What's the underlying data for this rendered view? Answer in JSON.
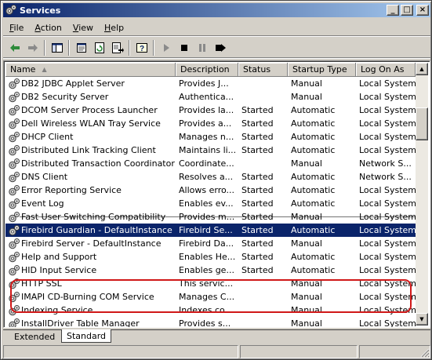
{
  "window": {
    "title": "Services",
    "minimize": "_",
    "maximize": "□",
    "close": "×"
  },
  "menu": [
    "File",
    "Action",
    "View",
    "Help"
  ],
  "toolbar": {
    "buttons": [
      "back-icon",
      "forward-icon",
      "show-hide-tree-icon",
      "properties-icon",
      "refresh-icon",
      "export-list-icon",
      "help-icon",
      "start-service-icon",
      "stop-service-icon",
      "pause-service-icon",
      "restart-service-icon"
    ]
  },
  "columns": [
    "Name",
    "Description",
    "Status",
    "Startup Type",
    "Log On As"
  ],
  "sort_indicator": "▲",
  "rows": [
    {
      "name": "DB2 JDBC Applet Server",
      "desc": "Provides J...",
      "status": "",
      "startup": "Manual",
      "logon": "Local System"
    },
    {
      "name": "DB2 Security Server",
      "desc": "Authentica...",
      "status": "",
      "startup": "Manual",
      "logon": "Local System"
    },
    {
      "name": "DCOM Server Process Launcher",
      "desc": "Provides la...",
      "status": "Started",
      "startup": "Automatic",
      "logon": "Local System"
    },
    {
      "name": "Dell Wireless WLAN Tray Service",
      "desc": "Provides a...",
      "status": "Started",
      "startup": "Automatic",
      "logon": "Local System"
    },
    {
      "name": "DHCP Client",
      "desc": "Manages n...",
      "status": "Started",
      "startup": "Automatic",
      "logon": "Local System"
    },
    {
      "name": "Distributed Link Tracking Client",
      "desc": "Maintains li...",
      "status": "Started",
      "startup": "Automatic",
      "logon": "Local System"
    },
    {
      "name": "Distributed Transaction Coordinator",
      "desc": "Coordinate...",
      "status": "",
      "startup": "Manual",
      "logon": "Network S..."
    },
    {
      "name": "DNS Client",
      "desc": "Resolves a...",
      "status": "Started",
      "startup": "Automatic",
      "logon": "Network S..."
    },
    {
      "name": "Error Reporting Service",
      "desc": "Allows erro...",
      "status": "Started",
      "startup": "Automatic",
      "logon": "Local System"
    },
    {
      "name": "Event Log",
      "desc": "Enables ev...",
      "status": "Started",
      "startup": "Automatic",
      "logon": "Local System"
    },
    {
      "name": "Fast User Switching Compatibility",
      "desc": "Provides m...",
      "status": "Started",
      "startup": "Manual",
      "logon": "Local System"
    },
    {
      "name": "Firebird Guardian - DefaultInstance",
      "desc": "Firebird Se...",
      "status": "Started",
      "startup": "Automatic",
      "logon": "Local System"
    },
    {
      "name": "Firebird Server - DefaultInstance",
      "desc": "Firebird Da...",
      "status": "Started",
      "startup": "Manual",
      "logon": "Local System"
    },
    {
      "name": "Help and Support",
      "desc": "Enables He...",
      "status": "Started",
      "startup": "Automatic",
      "logon": "Local System"
    },
    {
      "name": "HID Input Service",
      "desc": "Enables ge...",
      "status": "Started",
      "startup": "Automatic",
      "logon": "Local System"
    },
    {
      "name": "HTTP SSL",
      "desc": "This servic...",
      "status": "",
      "startup": "Manual",
      "logon": "Local System"
    },
    {
      "name": "IMAPI CD-Burning COM Service",
      "desc": "Manages C...",
      "status": "",
      "startup": "Manual",
      "logon": "Local System"
    },
    {
      "name": "Indexing Service",
      "desc": "Indexes co...",
      "status": "",
      "startup": "Manual",
      "logon": "Local System"
    },
    {
      "name": "InstallDriver Table Manager",
      "desc": "Provides s...",
      "status": "",
      "startup": "Manual",
      "logon": "Local System"
    }
  ],
  "selected_row": 11,
  "strikethrough_row": 10,
  "tabs": [
    "Extended",
    "Standard"
  ],
  "active_tab": "Standard",
  "colors": {
    "title_start": "#0a246a",
    "title_end": "#a6caf0",
    "selection": "#0a246a",
    "highlight_outline": "#d01818"
  }
}
